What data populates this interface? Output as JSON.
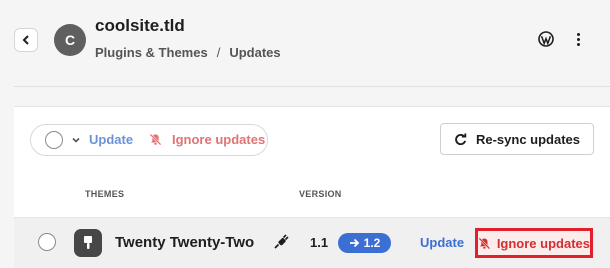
{
  "header": {
    "back_icon": "chevron-left-icon",
    "avatar_letter": "C",
    "site_title": "coolsite.tld",
    "breadcrumb": {
      "parent": "Plugins & Themes",
      "separator": "/",
      "current": "Updates"
    },
    "wordpress_icon": "wordpress-icon",
    "more_icon": "kebab-menu-icon"
  },
  "toolbar": {
    "update_label": "Update",
    "ignore_label": "Ignore updates",
    "resync_label": "Re-sync updates"
  },
  "table": {
    "columns": {
      "themes": "THEMES",
      "version": "VERSION"
    },
    "rows": [
      {
        "name": "Twenty Twenty-Two",
        "current_version": "1.1",
        "new_version": "1.2",
        "update_label": "Update",
        "ignore_label": "Ignore updates"
      }
    ]
  },
  "colors": {
    "accent_blue": "#3b6fd4",
    "danger_red": "#d32f2f",
    "highlight_border": "#e0202a",
    "avatar_bg": "#5f5f5f",
    "theme_icon_bg": "#474747"
  }
}
